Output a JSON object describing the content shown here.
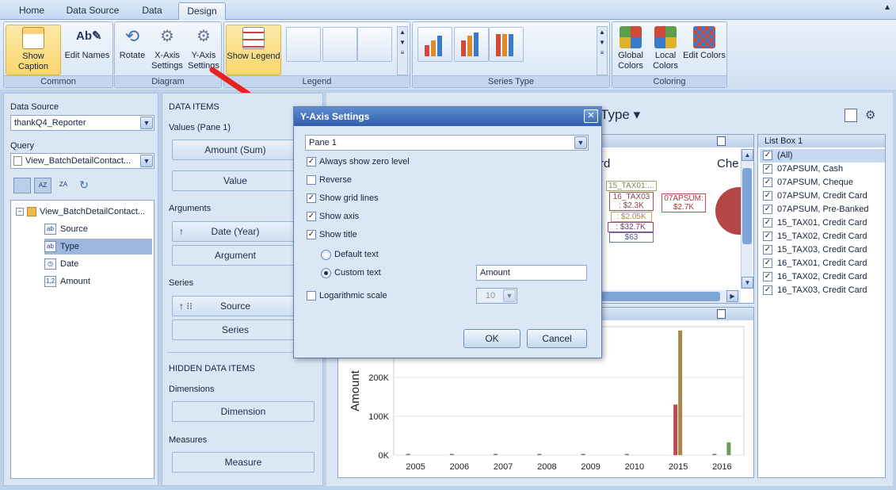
{
  "tabs": [
    "Home",
    "Data Source",
    "Data",
    "Design"
  ],
  "ribbon": {
    "common": {
      "caption": "Common",
      "show_caption": "Show Caption",
      "edit_names": "Edit Names"
    },
    "diagram": {
      "caption": "Diagram",
      "rotate": "Rotate",
      "x_axis": "X-Axis Settings",
      "y_axis": "Y-Axis Settings",
      "x1": "X-Axis",
      "x2": "Settings",
      "y1": "Y-Axis",
      "y2": "Settings"
    },
    "legend": {
      "caption": "Legend",
      "show_legend": "Show Legend"
    },
    "series_type": {
      "caption": "Series Type"
    },
    "coloring": {
      "caption": "Coloring",
      "global1": "Global",
      "global2": "Colors",
      "local1": "Local",
      "local2": "Colors",
      "edit_colors": "Edit Colors"
    }
  },
  "left_panel": {
    "data_source_label": "Data Source",
    "data_source_value": "thankQ4_Reporter",
    "query_label": "Query",
    "query_value": "View_BatchDetailContact...",
    "tree_root": "View_BatchDetailContact...",
    "fields": [
      {
        "icon": "ab",
        "name": "Source"
      },
      {
        "icon": "ab",
        "name": "Type"
      },
      {
        "icon": "clock",
        "name": "Date"
      },
      {
        "icon": "1,2",
        "name": "Amount"
      }
    ]
  },
  "data_items": {
    "header": "DATA ITEMS",
    "values_label": "Values (Pane 1)",
    "value_items": [
      "Amount (Sum)",
      "Value"
    ],
    "arguments_label": "Arguments",
    "argument_items": [
      "Date (Year)",
      "Argument"
    ],
    "series_label": "Series",
    "series_items": [
      "Source",
      "Series"
    ],
    "hidden_header": "HIDDEN DATA ITEMS",
    "dimensions_label": "Dimensions",
    "dimension_item": "Dimension",
    "measures_label": "Measures",
    "measure_item": "Measure"
  },
  "dashboard": {
    "title_fragment": "Type",
    "pie_labels": [
      "15_TAX01:...",
      "16_TAX03",
      ": $2.3K",
      ": $2.05K",
      ": $32.7K",
      "$63",
      "07APSUM:",
      "$2.7K"
    ],
    "pie_titles": [
      "rd",
      "Che"
    ]
  },
  "chart_data": {
    "type": "bar",
    "ylabel": "Amount",
    "y_ticks": [
      "0K",
      "100K",
      "200K"
    ],
    "categories": [
      "2005",
      "2006",
      "2007",
      "2008",
      "2009",
      "2010",
      "2015",
      "2016"
    ],
    "ylim": [
      0,
      330000
    ],
    "series": [
      {
        "color": "#5d7f91",
        "values": [
          2000,
          1500,
          800,
          300,
          200,
          1000,
          0,
          2500
        ]
      },
      {
        "color": "#b84c4c",
        "values": [
          0,
          0,
          0,
          0,
          0,
          0,
          130000,
          0
        ]
      },
      {
        "color": "#a6894a",
        "values": [
          0,
          0,
          0,
          0,
          0,
          0,
          320000,
          0
        ]
      },
      {
        "color": "#6b9a5b",
        "values": [
          0,
          0,
          0,
          0,
          0,
          0,
          0,
          32700
        ]
      }
    ]
  },
  "list_box": {
    "title": "List Box 1",
    "items": [
      "(All)",
      "07APSUM, Cash",
      "07APSUM, Cheque",
      "07APSUM, Credit Card",
      "07APSUM, Pre-Banked",
      "15_TAX01, Credit Card",
      "15_TAX02, Credit Card",
      "15_TAX03, Credit Card",
      "16_TAX01, Credit Card",
      "16_TAX02, Credit Card",
      "16_TAX03, Credit Card"
    ]
  },
  "dialog": {
    "title": "Y-Axis Settings",
    "pane": "Pane 1",
    "always_zero": "Always show zero level",
    "reverse": "Reverse",
    "grid_lines": "Show grid lines",
    "show_axis": "Show axis",
    "show_title": "Show title",
    "default_text": "Default text",
    "custom_text": "Custom text",
    "custom_value": "Amount",
    "log_scale": "Logarithmic scale",
    "log_base": "10",
    "ok": "OK",
    "cancel": "Cancel",
    "checked": {
      "always_zero": true,
      "reverse": false,
      "grid_lines": true,
      "show_axis": true,
      "show_title": true,
      "log_scale": false
    }
  }
}
